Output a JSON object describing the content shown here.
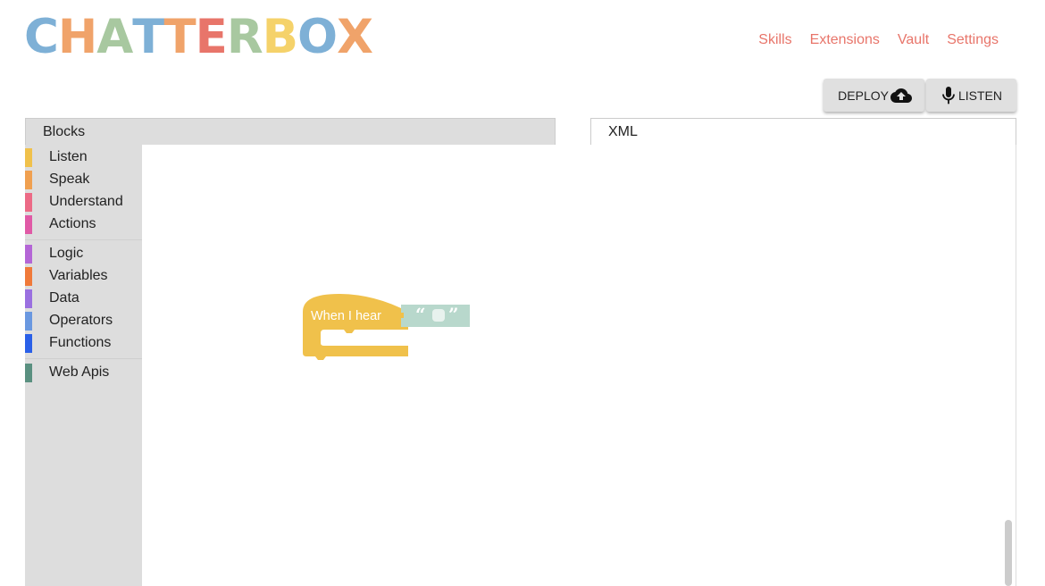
{
  "logo": {
    "letters": [
      "C",
      "H",
      "A",
      "T",
      "T",
      "E",
      "R",
      "B",
      "O",
      "X"
    ],
    "colors": [
      "#7eb0d6",
      "#f0a36a",
      "#a8c8a0",
      "#7eb0d6",
      "#f0a36a",
      "#e8756a",
      "#a8c8a0",
      "#f5d26a",
      "#7eb0d6",
      "#f0a36a"
    ]
  },
  "nav": {
    "items": [
      "Skills",
      "Extensions",
      "Vault",
      "Settings"
    ],
    "color": "#e8756a"
  },
  "toolbar": {
    "deploy_label": "DEPLOY",
    "deploy_icon": "cloud-upload-icon",
    "listen_label": "LISTEN",
    "listen_icon": "microphone-icon"
  },
  "tabs": {
    "blocks": "Blocks",
    "xml": "XML"
  },
  "toolbox": {
    "groups": [
      [
        {
          "label": "Listen",
          "color": "#f0c14b"
        },
        {
          "label": "Speak",
          "color": "#f0a050"
        },
        {
          "label": "Understand",
          "color": "#ec6a86"
        },
        {
          "label": "Actions",
          "color": "#e05aa6"
        }
      ],
      [
        {
          "label": "Logic",
          "color": "#b466d6"
        },
        {
          "label": "Variables",
          "color": "#f07a3a"
        },
        {
          "label": "Data",
          "color": "#9a70e0"
        },
        {
          "label": "Operators",
          "color": "#6a98e0"
        },
        {
          "label": "Functions",
          "color": "#2a60e8"
        }
      ],
      [
        {
          "label": "Web Apis",
          "color": "#5a9080"
        }
      ]
    ]
  },
  "block": {
    "label": "When I hear",
    "color": "#f0c14b",
    "text_color": "#ffffff",
    "input_color": "#b8d8cc",
    "open_quote": "“",
    "close_quote": "”"
  }
}
